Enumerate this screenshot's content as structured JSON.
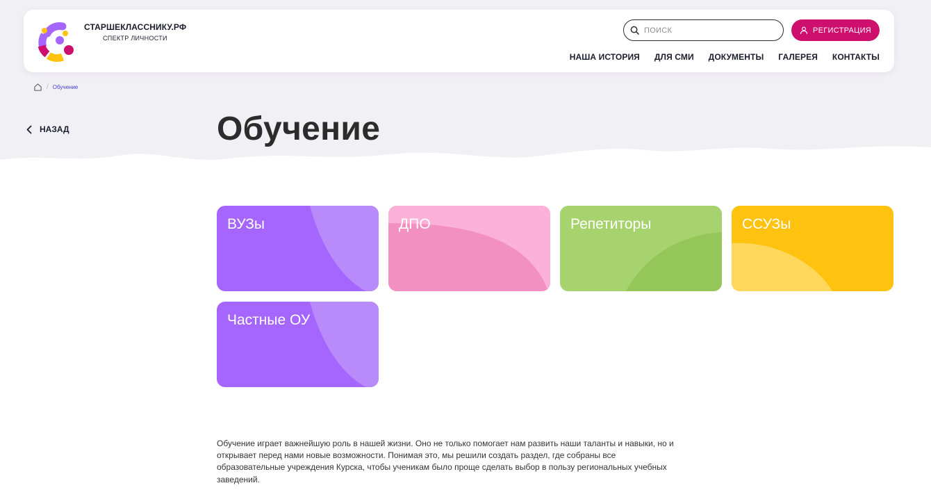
{
  "header": {
    "brand_name": "СТАРШЕКЛАССНИКУ.РФ",
    "brand_sub": "СПЕКТР ЛИЧНОСТИ",
    "search_placeholder": "ПОИСК",
    "register_label": "РЕГИСТРАЦИЯ",
    "nav": [
      "НАША ИСТОРИЯ",
      "ДЛЯ СМИ",
      "ДОКУМЕНТЫ",
      "ГАЛЕРЕЯ",
      "КОНТАКТЫ"
    ]
  },
  "breadcrumb": {
    "current": "Обучение"
  },
  "back_label": "НАЗАД",
  "page_title": "Обучение",
  "cards": [
    {
      "label": "ВУЗы",
      "color": "#a566ff"
    },
    {
      "label": "ДПО",
      "color": "#f291c1"
    },
    {
      "label": "Репетиторы",
      "color": "#a7d36e"
    },
    {
      "label": "ССУЗы",
      "color": "#ffc20e"
    },
    {
      "label": "Частные ОУ",
      "color": "#a566ff"
    }
  ],
  "description": "Обучение играет важнейшую роль в нашей жизни. Оно не только помогает нам развить наши таланты и навыки, но и открывает перед нами новые возможности. Понимая это, мы решили создать раздел, где собраны все образовательные учреждения Курска, чтобы ученикам было проще сделать выбор в пользу региональных учебных заведений.",
  "colors": {
    "accent": "#cf0f6e",
    "breadcrumb_link": "#4a3ec7",
    "hero_bg": "#f1f0f5"
  }
}
